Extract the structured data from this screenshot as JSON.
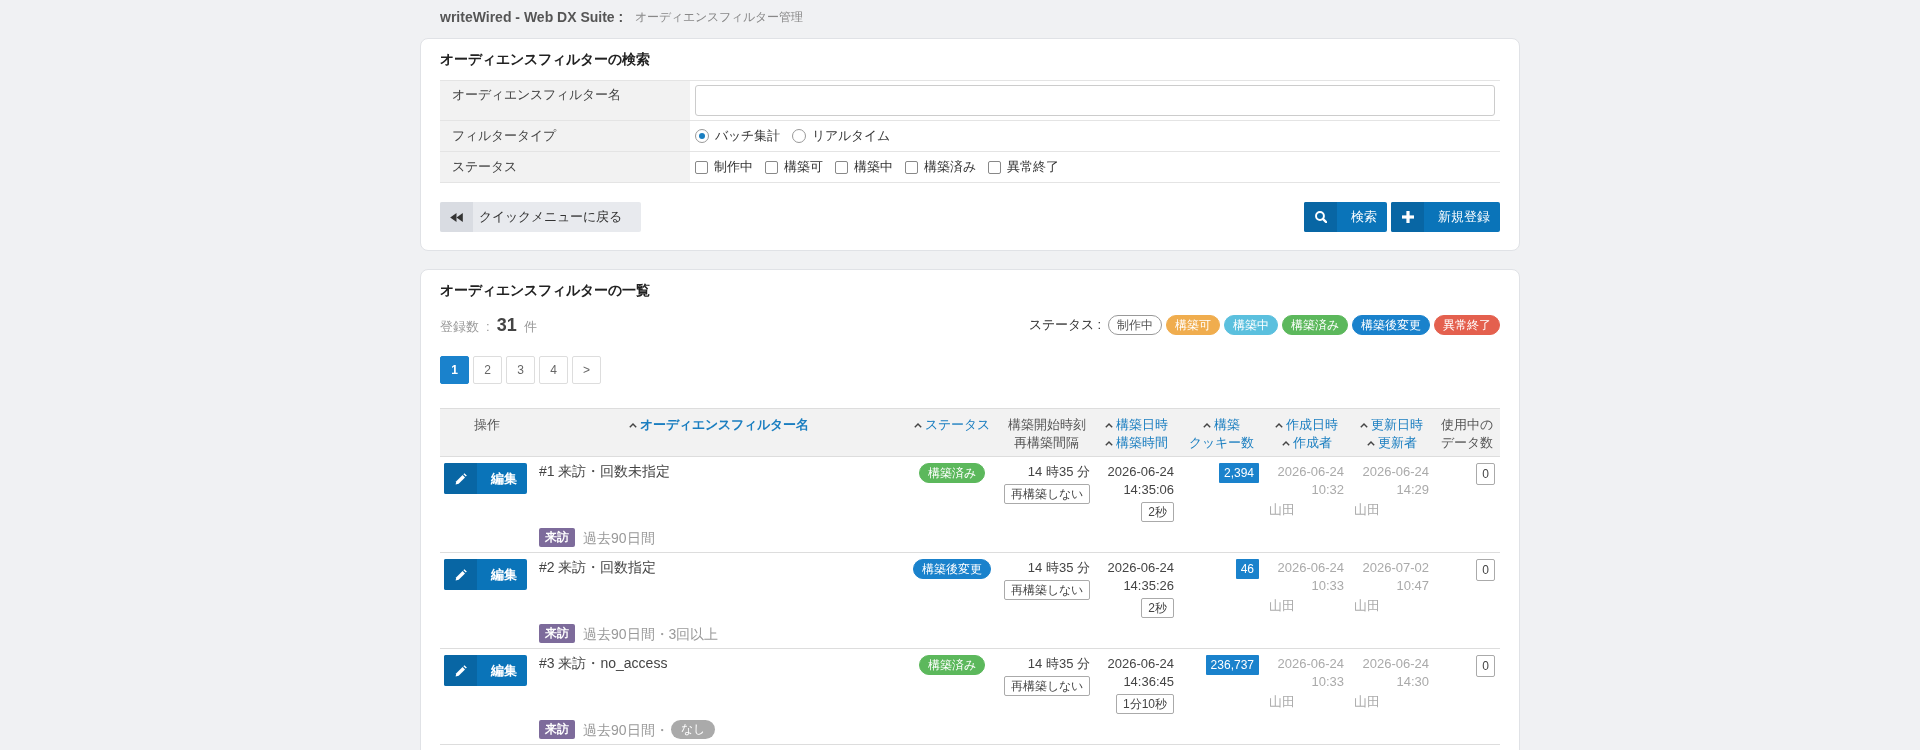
{
  "header": {
    "app_name": "writeWired - Web DX Suite :",
    "page_title": "オーディエンスフィルター管理"
  },
  "search": {
    "title": "オーディエンスフィルターの検索",
    "fields": [
      {
        "kind": "text",
        "label": "オーディエンスフィルター名"
      },
      {
        "kind": "radio",
        "label": "フィルタータイプ",
        "options": [
          {
            "label": "バッチ集計",
            "selected": true
          },
          {
            "label": "リアルタイム",
            "selected": false
          }
        ]
      },
      {
        "kind": "checkbox",
        "label": "ステータス",
        "options": [
          {
            "label": "制作中",
            "checked": false
          },
          {
            "label": "構築可",
            "checked": false
          },
          {
            "label": "構築中",
            "checked": false
          },
          {
            "label": "構築済み",
            "checked": false
          },
          {
            "label": "異常終了",
            "checked": false
          }
        ]
      }
    ],
    "back_button": "クイックメニューに戻る",
    "actions": [
      {
        "kind": "search",
        "label": "検索"
      },
      {
        "kind": "add",
        "label": "新規登録"
      }
    ]
  },
  "list": {
    "title": "オーディエンスフィルターの一覧",
    "count_label": "登録数",
    "count_separator": ":",
    "count": "31",
    "count_unit": "件",
    "legend_label": "ステータス :",
    "legend": [
      {
        "label": "制作中",
        "color": "#ffffff"
      },
      {
        "label": "構築可",
        "color": "#f0ad4e"
      },
      {
        "label": "構築中",
        "color": "#5bc0de"
      },
      {
        "label": "構築済み",
        "color": "#5cb85c"
      },
      {
        "label": "構築後変更",
        "color": "#1a82cc"
      },
      {
        "label": "異常終了",
        "color": "#e4604e"
      }
    ],
    "pagination": [
      {
        "label": "1",
        "selected": true
      },
      {
        "label": "2",
        "selected": false
      },
      {
        "label": "3",
        "selected": false
      },
      {
        "label": "4",
        "selected": false
      },
      {
        "label": ">",
        "selected": false
      }
    ],
    "columns": [
      {
        "sortable": false,
        "sorted": false,
        "lines": [
          {
            "label": "操作",
            "caret": false
          }
        ]
      },
      {
        "sortable": true,
        "sorted": true,
        "lines": [
          {
            "label": "オーディエンスフィルター名",
            "caret": true
          }
        ]
      },
      {
        "sortable": true,
        "sorted": false,
        "lines": [
          {
            "label": "ステータス",
            "caret": true
          }
        ]
      },
      {
        "sortable": false,
        "sorted": false,
        "lines": [
          {
            "label": "構築開始時刻",
            "caret": false
          },
          {
            "label": "再構築間隔",
            "caret": false
          }
        ]
      },
      {
        "sortable": true,
        "sorted": false,
        "lines": [
          {
            "label": "構築日時",
            "caret": true
          },
          {
            "label": "構築時間",
            "caret": true
          }
        ]
      },
      {
        "sortable": true,
        "sorted": false,
        "lines": [
          {
            "label": "構築",
            "caret": true
          },
          {
            "label": "クッキー数",
            "caret": false
          }
        ]
      },
      {
        "sortable": true,
        "sorted": false,
        "lines": [
          {
            "label": "作成日時",
            "caret": true
          },
          {
            "label": "作成者",
            "caret": true
          }
        ]
      },
      {
        "sortable": true,
        "sorted": false,
        "lines": [
          {
            "label": "更新日時",
            "caret": true
          },
          {
            "label": "更新者",
            "caret": true
          }
        ]
      },
      {
        "sortable": false,
        "sorted": false,
        "lines": [
          {
            "label": "使用中の",
            "caret": false
          },
          {
            "label": "データ数",
            "caret": false
          }
        ]
      }
    ],
    "rows": [
      {
        "edit_label": "編集",
        "name": "#1 来訪・回数未指定",
        "category": {
          "label": "来訪",
          "color": "#7d6b9b"
        },
        "condition": "過去90日間",
        "status": {
          "label": "構築済み",
          "color": "#5cb85c"
        },
        "start_time": "14 時35 分",
        "interval": "再構築しない",
        "build_date": "2026-06-24",
        "build_time": "14:35:06",
        "duration": "2秒",
        "cookie_count": "2,394",
        "created_date": "2026-06-24",
        "created_time": "10:32",
        "creator": "山田",
        "updated_date": "2026-06-24",
        "updated_time": "14:29",
        "updater": "山田",
        "in_use": "0"
      },
      {
        "edit_label": "編集",
        "name": "#2 来訪・回数指定",
        "category": {
          "label": "来訪",
          "color": "#7d6b9b"
        },
        "condition": "過去90日間・3回以上",
        "status": {
          "label": "構築後変更",
          "color": "#1a82cc"
        },
        "start_time": "14 時35 分",
        "interval": "再構築しない",
        "build_date": "2026-06-24",
        "build_time": "14:35:26",
        "duration": "2秒",
        "cookie_count": "46",
        "created_date": "2026-06-24",
        "created_time": "10:33",
        "creator": "山田",
        "updated_date": "2026-07-02",
        "updated_time": "10:47",
        "updater": "山田",
        "in_use": "0"
      },
      {
        "edit_label": "編集",
        "name": "#3 来訪・no_access",
        "category": {
          "label": "来訪",
          "color": "#7d6b9b"
        },
        "condition": "過去90日間・",
        "badge": "なし",
        "status": {
          "label": "構築済み",
          "color": "#5cb85c"
        },
        "start_time": "14 時35 分",
        "interval": "再構築しない",
        "build_date": "2026-06-24",
        "build_time": "14:36:45",
        "duration": "1分10秒",
        "cookie_count": "236,737",
        "created_date": "2026-06-24",
        "created_time": "10:33",
        "creator": "山田",
        "updated_date": "2026-06-24",
        "updated_time": "14:30",
        "updater": "山田",
        "in_use": "0"
      }
    ]
  }
}
